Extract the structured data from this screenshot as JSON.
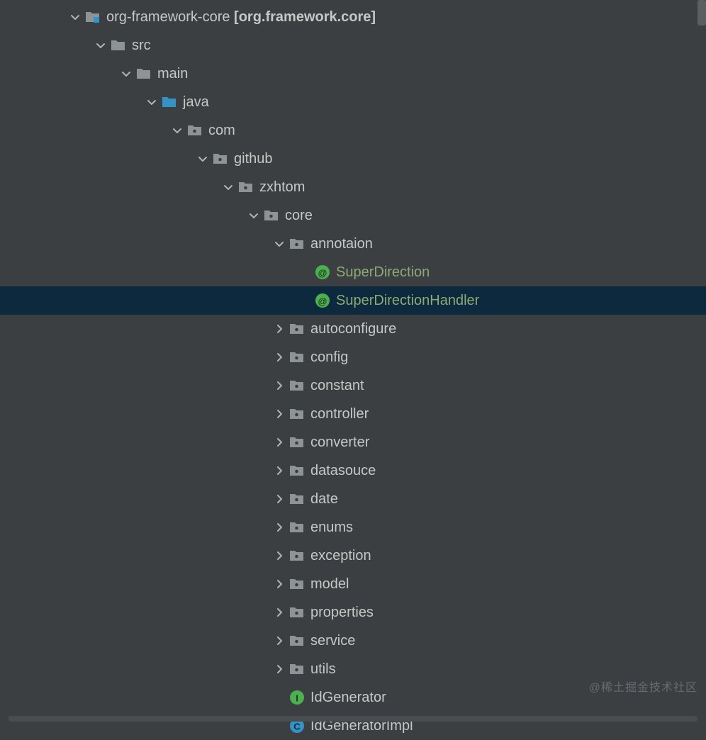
{
  "watermark": "@稀土掘金技术社区",
  "tree": [
    {
      "depth": 0,
      "arrow": "down",
      "icon": "module-folder",
      "label": "org-framework-core",
      "suffix": " [org.framework.core]",
      "green": false,
      "selected": false
    },
    {
      "depth": 1,
      "arrow": "down",
      "icon": "folder-gray",
      "label": "src",
      "green": false,
      "selected": false
    },
    {
      "depth": 2,
      "arrow": "down",
      "icon": "folder-gray",
      "label": "main",
      "green": false,
      "selected": false
    },
    {
      "depth": 3,
      "arrow": "down",
      "icon": "folder-blue",
      "label": "java",
      "green": false,
      "selected": false
    },
    {
      "depth": 4,
      "arrow": "down",
      "icon": "package",
      "label": "com",
      "green": false,
      "selected": false
    },
    {
      "depth": 5,
      "arrow": "down",
      "icon": "package",
      "label": "github",
      "green": false,
      "selected": false
    },
    {
      "depth": 6,
      "arrow": "down",
      "icon": "package",
      "label": "zxhtom",
      "green": false,
      "selected": false
    },
    {
      "depth": 7,
      "arrow": "down",
      "icon": "package",
      "label": "core",
      "green": false,
      "selected": false
    },
    {
      "depth": 8,
      "arrow": "down",
      "icon": "package",
      "label": "annotaion",
      "green": false,
      "selected": false
    },
    {
      "depth": 9,
      "arrow": "none",
      "icon": "annotation",
      "label": "SuperDirection",
      "green": true,
      "selected": false
    },
    {
      "depth": 9,
      "arrow": "none",
      "icon": "annotation",
      "label": "SuperDirectionHandler",
      "green": true,
      "selected": true
    },
    {
      "depth": 8,
      "arrow": "right",
      "icon": "package",
      "label": "autoconfigure",
      "green": false,
      "selected": false
    },
    {
      "depth": 8,
      "arrow": "right",
      "icon": "package",
      "label": "config",
      "green": false,
      "selected": false
    },
    {
      "depth": 8,
      "arrow": "right",
      "icon": "package",
      "label": "constant",
      "green": false,
      "selected": false
    },
    {
      "depth": 8,
      "arrow": "right",
      "icon": "package",
      "label": "controller",
      "green": false,
      "selected": false
    },
    {
      "depth": 8,
      "arrow": "right",
      "icon": "package",
      "label": "converter",
      "green": false,
      "selected": false
    },
    {
      "depth": 8,
      "arrow": "right",
      "icon": "package",
      "label": "datasouce",
      "green": false,
      "selected": false
    },
    {
      "depth": 8,
      "arrow": "right",
      "icon": "package",
      "label": "date",
      "green": false,
      "selected": false
    },
    {
      "depth": 8,
      "arrow": "right",
      "icon": "package",
      "label": "enums",
      "green": false,
      "selected": false
    },
    {
      "depth": 8,
      "arrow": "right",
      "icon": "package",
      "label": "exception",
      "green": false,
      "selected": false
    },
    {
      "depth": 8,
      "arrow": "right",
      "icon": "package",
      "label": "model",
      "green": false,
      "selected": false
    },
    {
      "depth": 8,
      "arrow": "right",
      "icon": "package",
      "label": "properties",
      "green": false,
      "selected": false
    },
    {
      "depth": 8,
      "arrow": "right",
      "icon": "package",
      "label": "service",
      "green": false,
      "selected": false
    },
    {
      "depth": 8,
      "arrow": "right",
      "icon": "package",
      "label": "utils",
      "green": false,
      "selected": false
    },
    {
      "depth": 8,
      "arrow": "none",
      "icon": "interface",
      "label": "IdGenerator",
      "green": false,
      "selected": false
    },
    {
      "depth": 8,
      "arrow": "none",
      "icon": "class",
      "label": "IdGeneratorImpl",
      "green": false,
      "selected": false
    }
  ]
}
